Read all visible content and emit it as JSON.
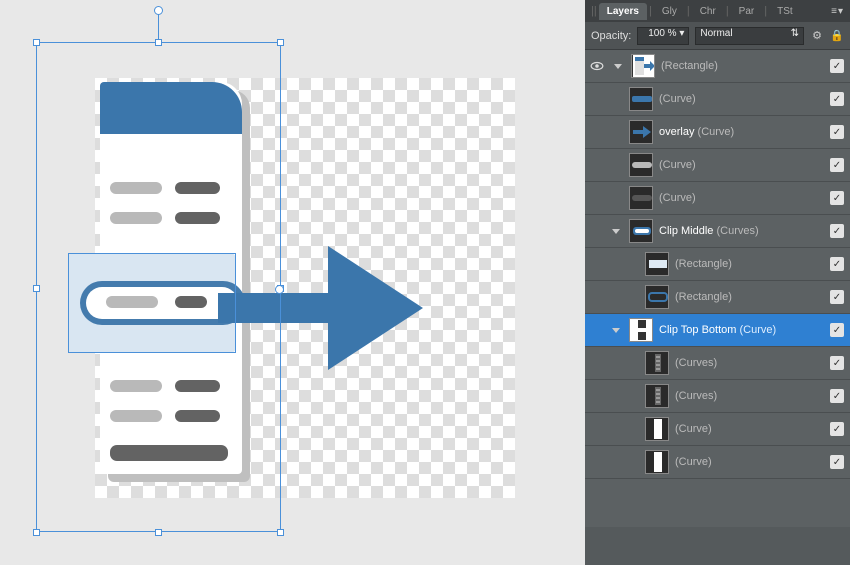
{
  "panel": {
    "tabs": [
      "Layers",
      "Gly",
      "Chr",
      "Par",
      "TSt"
    ],
    "active_tab": "Layers",
    "opacity_label": "Opacity:",
    "opacity_value": "100 % ▾",
    "blend_mode": "Normal",
    "gear_icon": "gear",
    "lock_icon": "lock"
  },
  "layers": [
    {
      "id": 0,
      "indent": 0,
      "expand": "open",
      "eye": true,
      "thumb": "doc-arrow",
      "primary": "",
      "secondary": "(Rectangle)",
      "checked": true
    },
    {
      "id": 1,
      "indent": 1,
      "thumb": "bar-blue",
      "primary": "",
      "secondary": "(Curve)",
      "checked": true
    },
    {
      "id": 2,
      "indent": 1,
      "thumb": "arrow-blue",
      "primary": "overlay",
      "secondary": "(Curve)",
      "checked": true
    },
    {
      "id": 3,
      "indent": 1,
      "thumb": "bar-grey",
      "primary": "",
      "secondary": "(Curve)",
      "checked": true
    },
    {
      "id": 4,
      "indent": 1,
      "thumb": "bar-dark",
      "primary": "",
      "secondary": "(Curve)",
      "checked": true
    },
    {
      "id": 5,
      "indent": 1,
      "expand": "open",
      "thumb": "clip-mid",
      "primary": "Clip Middle",
      "secondary": "(Curves)",
      "checked": true
    },
    {
      "id": 6,
      "indent": 2,
      "thumb": "rect-light",
      "primary": "",
      "secondary": "(Rectangle)",
      "checked": true
    },
    {
      "id": 7,
      "indent": 2,
      "thumb": "rect-outline",
      "primary": "",
      "secondary": "(Rectangle)",
      "checked": true
    },
    {
      "id": 8,
      "indent": 1,
      "expand": "open",
      "thumb": "clip-tb",
      "primary": "Clip Top Bottom",
      "secondary": "(Curve)",
      "checked": true,
      "selected": true
    },
    {
      "id": 9,
      "indent": 2,
      "thumb": "strip",
      "primary": "",
      "secondary": "(Curves)",
      "checked": true
    },
    {
      "id": 10,
      "indent": 2,
      "thumb": "strip",
      "primary": "",
      "secondary": "(Curves)",
      "checked": true
    },
    {
      "id": 11,
      "indent": 2,
      "thumb": "strip-wh",
      "primary": "",
      "secondary": "(Curve)",
      "checked": true
    },
    {
      "id": 12,
      "indent": 2,
      "thumb": "strip-wh",
      "primary": "",
      "secondary": "(Curve)",
      "checked": true
    }
  ]
}
